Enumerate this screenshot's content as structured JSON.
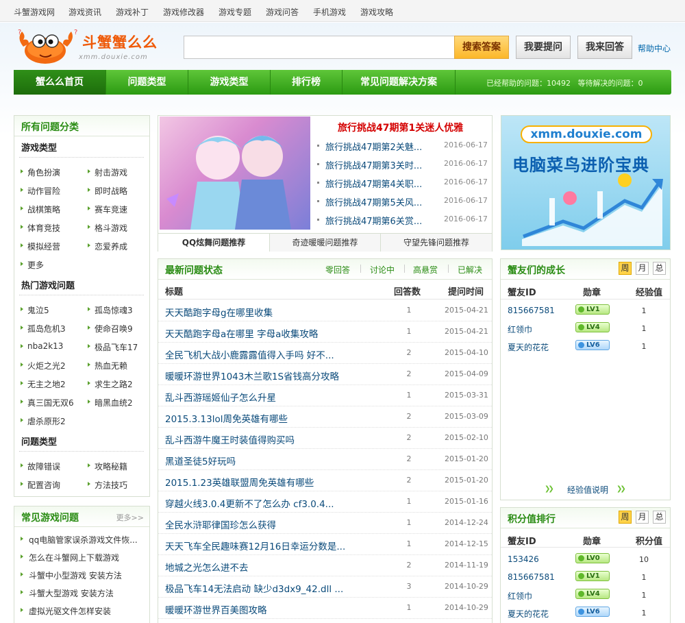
{
  "top_nav": [
    "斗蟹游戏网",
    "游戏资讯",
    "游戏补丁",
    "游戏修改器",
    "游戏专题",
    "游戏问答",
    "手机游戏",
    "游戏攻略"
  ],
  "logo": {
    "text": "斗蟹蟹么么",
    "subtitle": "xmm.douxie.com"
  },
  "search": {
    "placeholder": "",
    "button": "搜索答案"
  },
  "buttons": {
    "ask": "我要提问",
    "answer": "我来回答"
  },
  "help": "帮助中心",
  "main_nav": [
    "蟹么么首页",
    "问题类型",
    "游戏类型",
    "排行榜",
    "常见问题解决方案"
  ],
  "stats": {
    "helped_label": "已经帮助的问题：",
    "helped": "10492",
    "waiting_label": "等待解决的问题：",
    "waiting": "0"
  },
  "categories": {
    "title": "所有问题分类",
    "game_types": {
      "heading": "游戏类型",
      "items": [
        "角色扮演",
        "射击游戏",
        "动作冒险",
        "即时战略",
        "战棋策略",
        "赛车竞速",
        "体育竞技",
        "格斗游戏",
        "模拟经营",
        "恋爱养成",
        "更多"
      ]
    },
    "hot_games": {
      "heading": "热门游戏问题",
      "items": [
        "鬼泣5",
        "孤岛惊魂3",
        "孤岛危机3",
        "使命召唤9",
        "nba2k13",
        "极品飞车17",
        "火炬之光2",
        "热血无赖",
        "无主之地2",
        "求生之路2",
        "真三国无双6",
        "暗黑血统2",
        "虐杀原形2"
      ]
    },
    "question_types": {
      "heading": "问题类型",
      "items": [
        "故障错误",
        "攻略秘籍",
        "配置咨询",
        "方法技巧"
      ]
    }
  },
  "common_games": {
    "title": "常见游戏问题",
    "more": "更多>>",
    "items": [
      "qq电脑管家误杀游戏文件恢...",
      "怎么在斗蟹网上下载游戏",
      "斗蟹中小型游戏 安装方法",
      "斗蟹大型游戏 安装方法",
      "虚拟光驱文件怎样安装"
    ]
  },
  "slideshow": {
    "title": "旅行挑战47期第1关迷人优雅",
    "items": [
      {
        "title": "旅行挑战47期第2关魅...",
        "date": "2016-06-17"
      },
      {
        "title": "旅行挑战47期第3关时...",
        "date": "2016-06-17"
      },
      {
        "title": "旅行挑战47期第4关职...",
        "date": "2016-06-17"
      },
      {
        "title": "旅行挑战47期第5关风...",
        "date": "2016-06-17"
      },
      {
        "title": "旅行挑战47期第6关赏...",
        "date": "2016-06-17"
      }
    ],
    "tabs": [
      "QQ炫舞问题推荐",
      "奇迹暖暖问题推荐",
      "守望先锋问题推荐"
    ]
  },
  "latest": {
    "title": "最新问题状态",
    "tabs": [
      "零回答",
      "讨论中",
      "高悬赏",
      "已解决"
    ],
    "headers": [
      "标题",
      "回答数",
      "提问时间"
    ],
    "rows": [
      {
        "title": "天天酷跑字母g在哪里收集",
        "count": "1",
        "date": "2015-04-21"
      },
      {
        "title": "天天酷跑字母a在哪里 字母a收集攻略",
        "count": "1",
        "date": "2015-04-21"
      },
      {
        "title": "全民飞机大战小鹿露露值得入手吗 好不...",
        "count": "2",
        "date": "2015-04-10"
      },
      {
        "title": "暖暖环游世界1043木兰歌1S省钱高分攻略",
        "count": "2",
        "date": "2015-04-09"
      },
      {
        "title": "乱斗西游瑶姬仙子怎么升星",
        "count": "1",
        "date": "2015-03-31"
      },
      {
        "title": "2015.3.13lol周免英雄有哪些",
        "count": "2",
        "date": "2015-03-09"
      },
      {
        "title": "乱斗西游牛魔王时装值得购买吗",
        "count": "2",
        "date": "2015-02-10"
      },
      {
        "title": "黑道圣徒5好玩吗",
        "count": "2",
        "date": "2015-01-20"
      },
      {
        "title": "2015.1.23英雄联盟周免英雄有哪些",
        "count": "2",
        "date": "2015-01-20"
      },
      {
        "title": "穿越火线3.0.4更新不了怎么办 cf3.0.4...",
        "count": "1",
        "date": "2015-01-16"
      },
      {
        "title": "全民水浒耶律国珍怎么获得",
        "count": "1",
        "date": "2014-12-24"
      },
      {
        "title": "天天飞车全民趣味赛12月16日幸运分数是...",
        "count": "1",
        "date": "2014-12-15"
      },
      {
        "title": "地城之光怎么进不去",
        "count": "2",
        "date": "2014-11-19"
      },
      {
        "title": "极品飞车14无法启动 缺少d3dx9_42.dll ...",
        "count": "3",
        "date": "2014-10-29"
      },
      {
        "title": "暖暖环游世界百美图攻略",
        "count": "1",
        "date": "2014-10-29"
      }
    ]
  },
  "ad": {
    "url": "xmm.douxie.com",
    "text": "电脑菜鸟进阶宝典"
  },
  "growth": {
    "title": "蟹友们的成长",
    "toggles": [
      "周",
      "月",
      "总"
    ],
    "headers": [
      "蟹友ID",
      "勋章",
      "经验值"
    ],
    "rows": [
      {
        "id": "815667581",
        "badge": "LV1",
        "value": "1"
      },
      {
        "id": "红领巾",
        "badge": "LV4",
        "value": "1"
      },
      {
        "id": "夏天的花花",
        "badge": "LV6",
        "value": "1"
      }
    ],
    "footer": "经验值说明"
  },
  "points": {
    "title": "积分值排行",
    "toggles": [
      "周",
      "月",
      "总"
    ],
    "headers": [
      "蟹友ID",
      "勋章",
      "积分值"
    ],
    "rows": [
      {
        "id": "153426",
        "badge": "LV0",
        "value": "10"
      },
      {
        "id": "815667581",
        "badge": "LV1",
        "value": "1"
      },
      {
        "id": "红领巾",
        "badge": "LV4",
        "value": "1"
      },
      {
        "id": "夏天的花花",
        "badge": "LV6",
        "value": "1"
      }
    ]
  }
}
